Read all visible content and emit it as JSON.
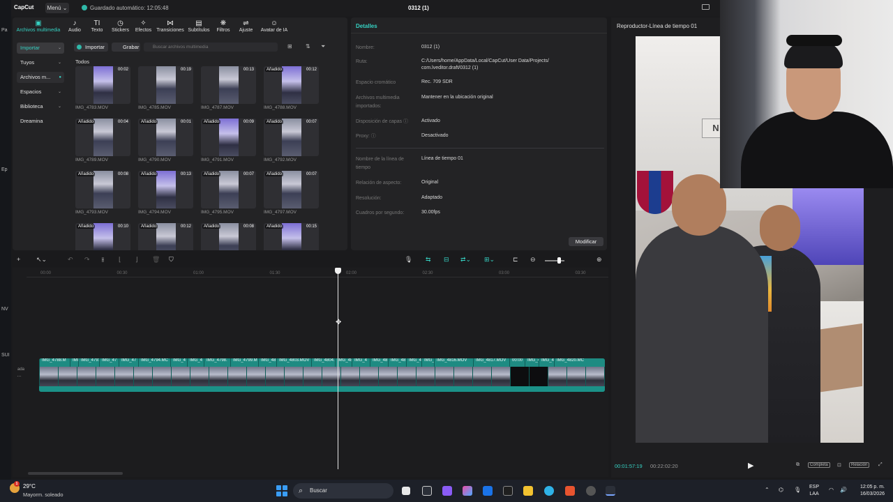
{
  "app": {
    "logo": "CapCut",
    "menu": "Menú ⌄",
    "autosave": "Guardado automático: 12:05:48",
    "project_title": "0312 (1)"
  },
  "media_tabs": [
    {
      "label": "Archivos multimedia",
      "icon": "▣"
    },
    {
      "label": "Audio",
      "icon": "♪"
    },
    {
      "label": "Texto",
      "icon": "TI"
    },
    {
      "label": "Stickers",
      "icon": "◷"
    },
    {
      "label": "Efectos",
      "icon": "✧"
    },
    {
      "label": "Transiciones",
      "icon": "⋈"
    },
    {
      "label": "Subtítulos",
      "icon": "▤"
    },
    {
      "label": "Filtros",
      "icon": "❋"
    },
    {
      "label": "Ajuste",
      "icon": "⇌"
    },
    {
      "label": "Avatar de IA",
      "icon": "☺"
    }
  ],
  "side_nav": [
    {
      "label": "Importar"
    },
    {
      "label": "Tuyos"
    },
    {
      "label": "Archivos m..."
    },
    {
      "label": "Espacios"
    },
    {
      "label": "Biblioteca"
    },
    {
      "label": "Dreamina"
    }
  ],
  "media_toolbar": {
    "import": "Importar",
    "record": "Grabar",
    "search_placeholder": "Buscar archivos multimedia",
    "section": "Todos"
  },
  "media_items": [
    {
      "name": "IMG_4783.MOV",
      "duration": "00:02",
      "added": ""
    },
    {
      "name": "IMG_4785.MOV",
      "duration": "00:19",
      "added": ""
    },
    {
      "name": "IMG_4787.MOV",
      "duration": "00:13",
      "added": ""
    },
    {
      "name": "IMG_4788.MOV",
      "duration": "00:12",
      "added": "Añadido"
    },
    {
      "name": "IMG_4789.MOV",
      "duration": "00:04",
      "added": "Añadido"
    },
    {
      "name": "IMG_4790.MOV",
      "duration": "00:01",
      "added": "Añadido"
    },
    {
      "name": "IMG_4791.MOV",
      "duration": "00:09",
      "added": "Añadido"
    },
    {
      "name": "IMG_4792.MOV",
      "duration": "00:07",
      "added": "Añadido"
    },
    {
      "name": "IMG_4793.MOV",
      "duration": "00:08",
      "added": "Añadido"
    },
    {
      "name": "IMG_4794.MOV",
      "duration": "00:13",
      "added": "Añadido"
    },
    {
      "name": "IMG_4795.MOV",
      "duration": "00:07",
      "added": "Añadido"
    },
    {
      "name": "IMG_4797.MOV",
      "duration": "00:07",
      "added": "Añadido"
    },
    {
      "name": "",
      "duration": "00:10",
      "added": "Añadido"
    },
    {
      "name": "",
      "duration": "00:12",
      "added": "Añadido"
    },
    {
      "name": "",
      "duration": "00:08",
      "added": "Añadido"
    },
    {
      "name": "",
      "duration": "00:15",
      "added": "Añadido"
    }
  ],
  "details": {
    "title": "Detalles",
    "rows": [
      {
        "key": "Nombre:",
        "value": "0312 (1)"
      },
      {
        "key": "Ruta:",
        "value": "C:/Users/home/AppData/Local/CapCut/User Data/Projects/ com.lveditor.draft/0312 (1)"
      },
      {
        "key": "Espacio cromático",
        "value": "Rec. 709 SDR"
      },
      {
        "key": "Archivos multimedia importados:",
        "value": "Mantener en la ubicación original"
      },
      {
        "key": "Disposición de capas ⓘ",
        "value": "Activado"
      },
      {
        "key": "Proxy: ⓘ",
        "value": "Desactivado"
      },
      {
        "key": "Nombre de la línea de tiempo",
        "value": "Línea de tiempo 01"
      },
      {
        "key": "Relación de aspecto:",
        "value": "Original"
      },
      {
        "key": "Resolución:",
        "value": "Adaptado"
      },
      {
        "key": "Cuadros por segundo:",
        "value": "30.00fps"
      }
    ],
    "modify": "Modificar"
  },
  "player": {
    "title": "Reproductor-Línea de tiempo 01",
    "current": "00:01:57:19",
    "total": "00:22:02:20",
    "full": "Completa",
    "ratio": "Relación"
  },
  "timeline": {
    "ticks": [
      "00:00",
      "00:30",
      "01:00",
      "01:30",
      "02:00",
      "02:30",
      "03:00",
      "03:30"
    ],
    "clips": [
      "IMG_4788.M",
      "IMI",
      "IMG_4791",
      "IMG_47",
      "IMG_47",
      "IMG_4794.MC",
      "IMG_4",
      "IMG_4",
      "IMG_4798.",
      "IMG_4799.M",
      "IMG_48",
      "IMG_4803.MOV",
      "IMG_4804.",
      "IMG_48",
      "IMG_4",
      "IMG_48",
      "IMG_48",
      "IMG_4",
      "IMG_4",
      "IMG_4816.MOV",
      "IMG_4817.MOV",
      "00:00",
      "IMG_4",
      "IMG_4",
      "IMG_4820.MC"
    ],
    "track_side": "ada"
  },
  "taskbar": {
    "temp": "29°C",
    "weather": "Mayorm. soleado",
    "search": "Buscar",
    "lang1": "ESP",
    "lang2": "LAA",
    "time": "12:05 p. m.",
    "date": "16/03/2026"
  },
  "left_edge_text": [
    "Pa",
    "Ep",
    "NV",
    "SUI"
  ],
  "colors": {
    "accent": "#36d3c4",
    "track": "#167b74",
    "bg": "#1a1a1c"
  }
}
